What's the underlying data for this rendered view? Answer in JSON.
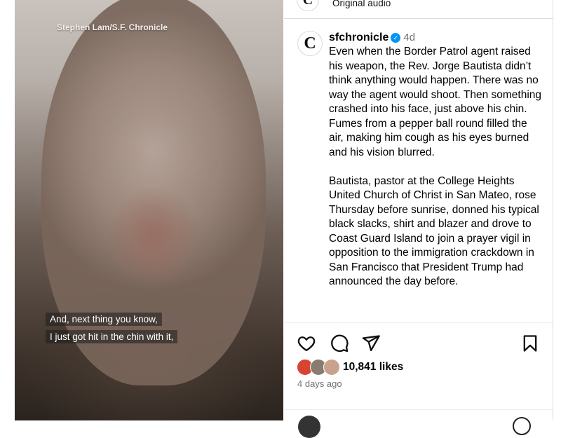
{
  "video": {
    "credit": "Stephen Lam/S.F. Chronicle",
    "subtitles": [
      "And, next thing you know,",
      "I just got hit in the chin with it,"
    ]
  },
  "audio": {
    "logo_letter": "C",
    "label": "Original audio"
  },
  "post": {
    "logo_letter": "C",
    "username": "sfchronicle",
    "verified_mark": "✓",
    "age": "4d",
    "paragraphs": [
      "Even when the Border Patrol agent raised his weapon, the Rev. Jorge Bautista didn’t think anything would happen. There was no way the agent would shoot. Then something crashed into his face, just above his chin. Fumes from a pepper ball round filled the air, making him cough as his eyes burned and his vision blurred.",
      "Bautista, pastor at the College Heights United Church of Christ in San Mateo, rose Thursday before sunrise, donned his typical black slacks, shirt and blazer and drove to Coast Guard Island to join a prayer vigil in opposition to the immigration crackdown in San Francisco that President Trump had announced the day before."
    ]
  },
  "actions": {
    "icons": [
      "heart-icon",
      "comment-icon",
      "share-icon",
      "bookmark-icon"
    ],
    "likes": "10,841 likes",
    "time_ago": "4 days ago"
  },
  "colors": {
    "accent": "#0095f6",
    "muted": "#737373",
    "border": "#dbdbdb"
  }
}
